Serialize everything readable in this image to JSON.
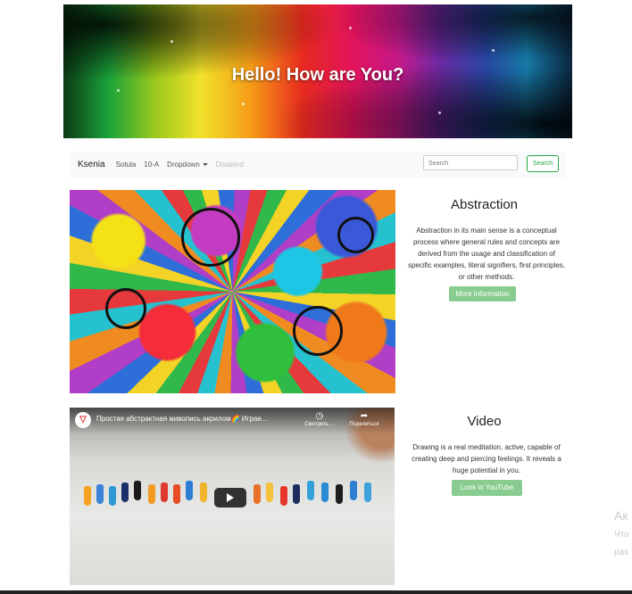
{
  "hero": {
    "title": "Hello! How are You?"
  },
  "navbar": {
    "brand": "Ksenia",
    "items": [
      "Sotula",
      "10-A",
      "Dropdown",
      "Disabled"
    ],
    "search_placeholder": "Search",
    "search_button": "Search"
  },
  "abstraction": {
    "title": "Abstraction",
    "text": "Abstraction in its main sense is a conceptual process where general rules and concepts are derived from the usage and classification of specific examples, literal signifiers, first principles, or other methods.",
    "button": "More information"
  },
  "video_section": {
    "title": "Video",
    "text": "Drawing is a real meditation, active, capable of creating deep and piercing feelings. It reveals a huge potential in you.",
    "button": "Look in YouTube",
    "player": {
      "title": "Простая абстрактная живопись акрилом🌈 Играе...",
      "watch_later": "Смотреть ...",
      "share": "Поделиться"
    }
  },
  "windows_watermark": {
    "line1": "Ак",
    "line2": "Что",
    "line3": "раз"
  },
  "colors": {
    "accent_green": "#28a745",
    "button_green": "#89cc8f",
    "navbar_bg": "#f8f9fa"
  }
}
